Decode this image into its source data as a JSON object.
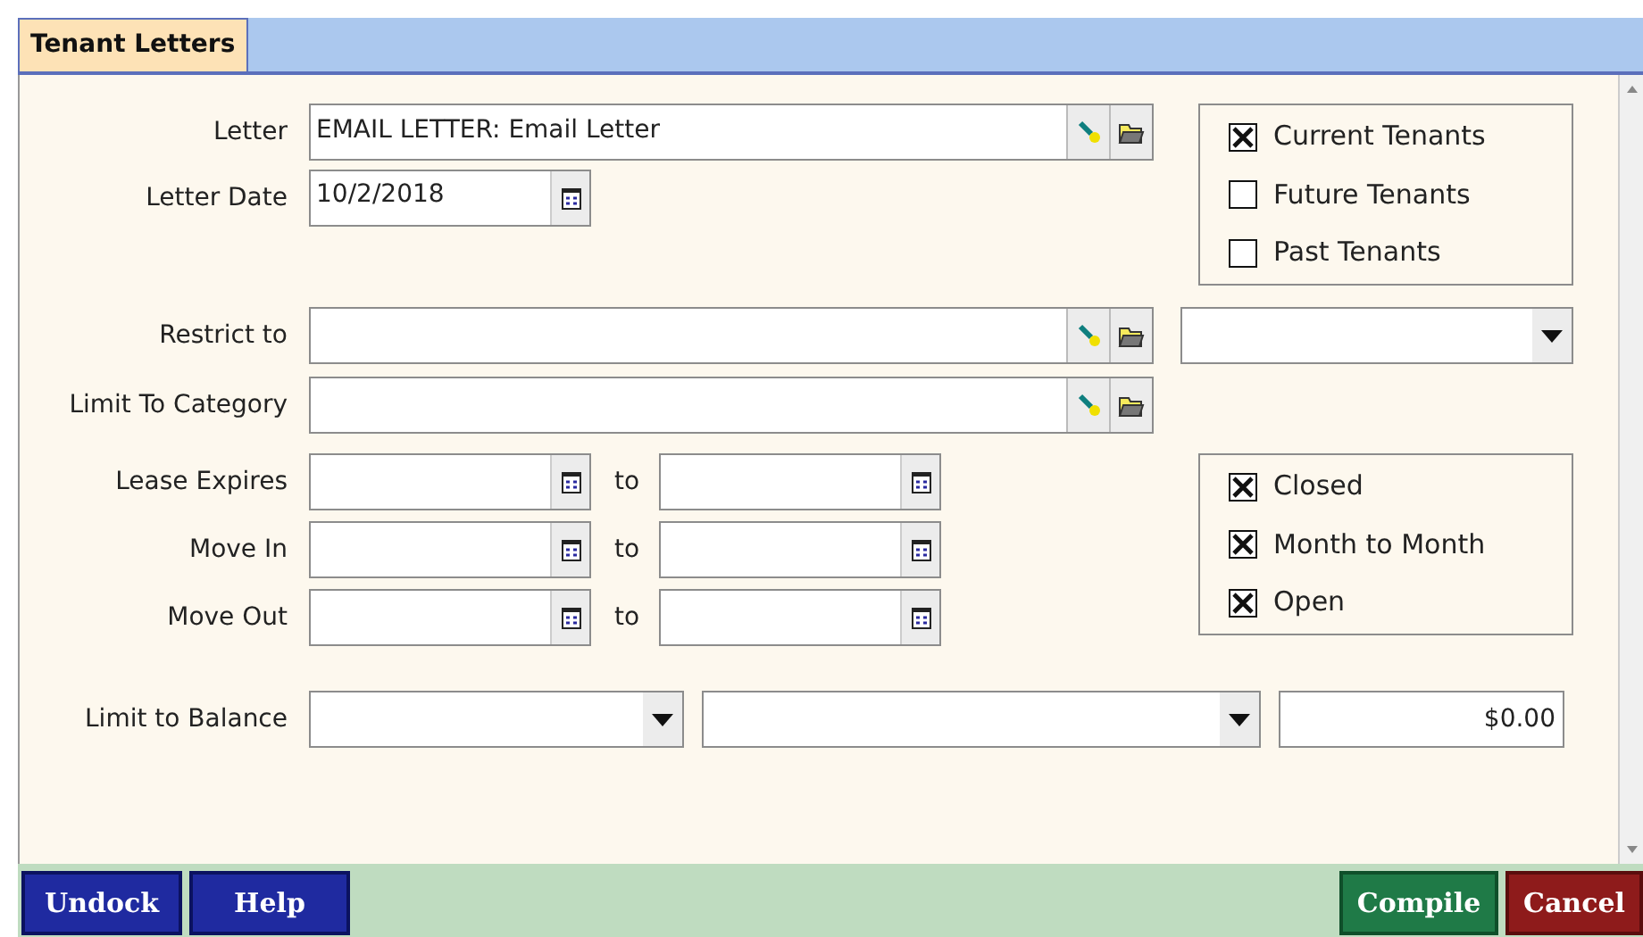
{
  "tab": {
    "label": "Tenant Letters",
    "selected": true
  },
  "letter": {
    "label": "Letter",
    "value": "EMAIL LETTER: Email Letter"
  },
  "letter_date": {
    "label": "Letter Date",
    "value": "10/2/2018"
  },
  "tenant_status": [
    {
      "label": "Current Tenants",
      "checked": true
    },
    {
      "label": "Future Tenants",
      "checked": false
    },
    {
      "label": "Past Tenants",
      "checked": false
    }
  ],
  "restrict_to": {
    "label": "Restrict to"
  },
  "limit_to_category": {
    "label": "Limit To Category"
  },
  "date_ranges": [
    {
      "label": "Lease Expires",
      "separator": "to"
    },
    {
      "label": "Move In",
      "separator": "to"
    },
    {
      "label": "Move Out",
      "separator": "to"
    }
  ],
  "lease_types": [
    {
      "label": "Closed",
      "checked": true
    },
    {
      "label": "Month to Month",
      "checked": true
    },
    {
      "label": "Open",
      "checked": true
    }
  ],
  "limit_to_balance": {
    "label": "Limit to Balance",
    "amount": "$0.00"
  },
  "buttons_left": [
    {
      "label": "Undock"
    },
    {
      "label": "Help"
    }
  ],
  "buttons_right": [
    {
      "label": "Compile",
      "kind": "compile"
    },
    {
      "label": "Cancel",
      "kind": "cancel"
    }
  ]
}
